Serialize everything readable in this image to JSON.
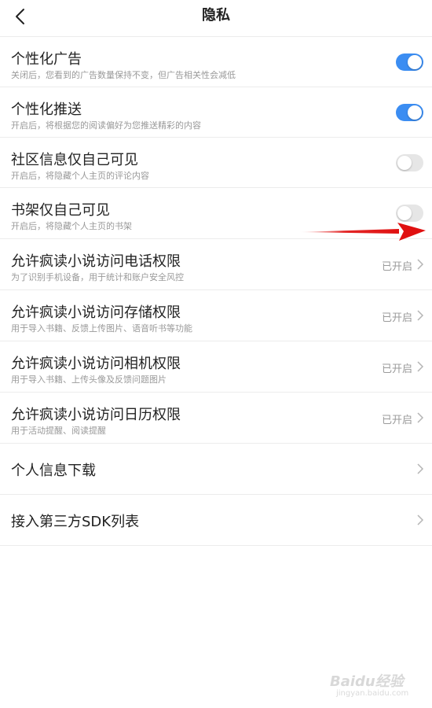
{
  "header": {
    "title": "隐私",
    "back_icon": "chevron-left-icon"
  },
  "toggle_rows": [
    {
      "title": "个性化广告",
      "subtitle": "关闭后，您看到的广告数量保持不变，但广告相关性会减低",
      "on": true
    },
    {
      "title": "个性化推送",
      "subtitle": "开启后，将根据您的阅读偏好为您推送精彩的内容",
      "on": true
    },
    {
      "title": "社区信息仅自己可见",
      "subtitle": "开启后，将隐藏个人主页的评论内容",
      "on": false
    },
    {
      "title": "书架仅自己可见",
      "subtitle": "开启后，将隐藏个人主页的书架",
      "on": false
    }
  ],
  "permission_rows": [
    {
      "title": "允许疯读小说访问电话权限",
      "subtitle": "为了识别手机设备，用于统计和账户安全风控",
      "status": "已开启"
    },
    {
      "title": "允许疯读小说访问存储权限",
      "subtitle": "用于导入书籍、反馈上传图片、语音听书等功能",
      "status": "已开启"
    },
    {
      "title": "允许疯读小说访问相机权限",
      "subtitle": "用于导入书籍、上传头像及反馈问题图片",
      "status": "已开启"
    },
    {
      "title": "允许疯读小说访问日历权限",
      "subtitle": "用于活动提醒、阅读提醒",
      "status": "已开启"
    }
  ],
  "link_rows": [
    {
      "title": "个人信息下载"
    },
    {
      "title": "接入第三方SDK列表"
    }
  ],
  "colors": {
    "toggle_on": "#3b8df2",
    "toggle_off": "#e6e6e6",
    "annotation_arrow": "#e01010"
  },
  "watermark": {
    "brand": "Baidu经验",
    "url": "jingyan.baidu.com"
  }
}
